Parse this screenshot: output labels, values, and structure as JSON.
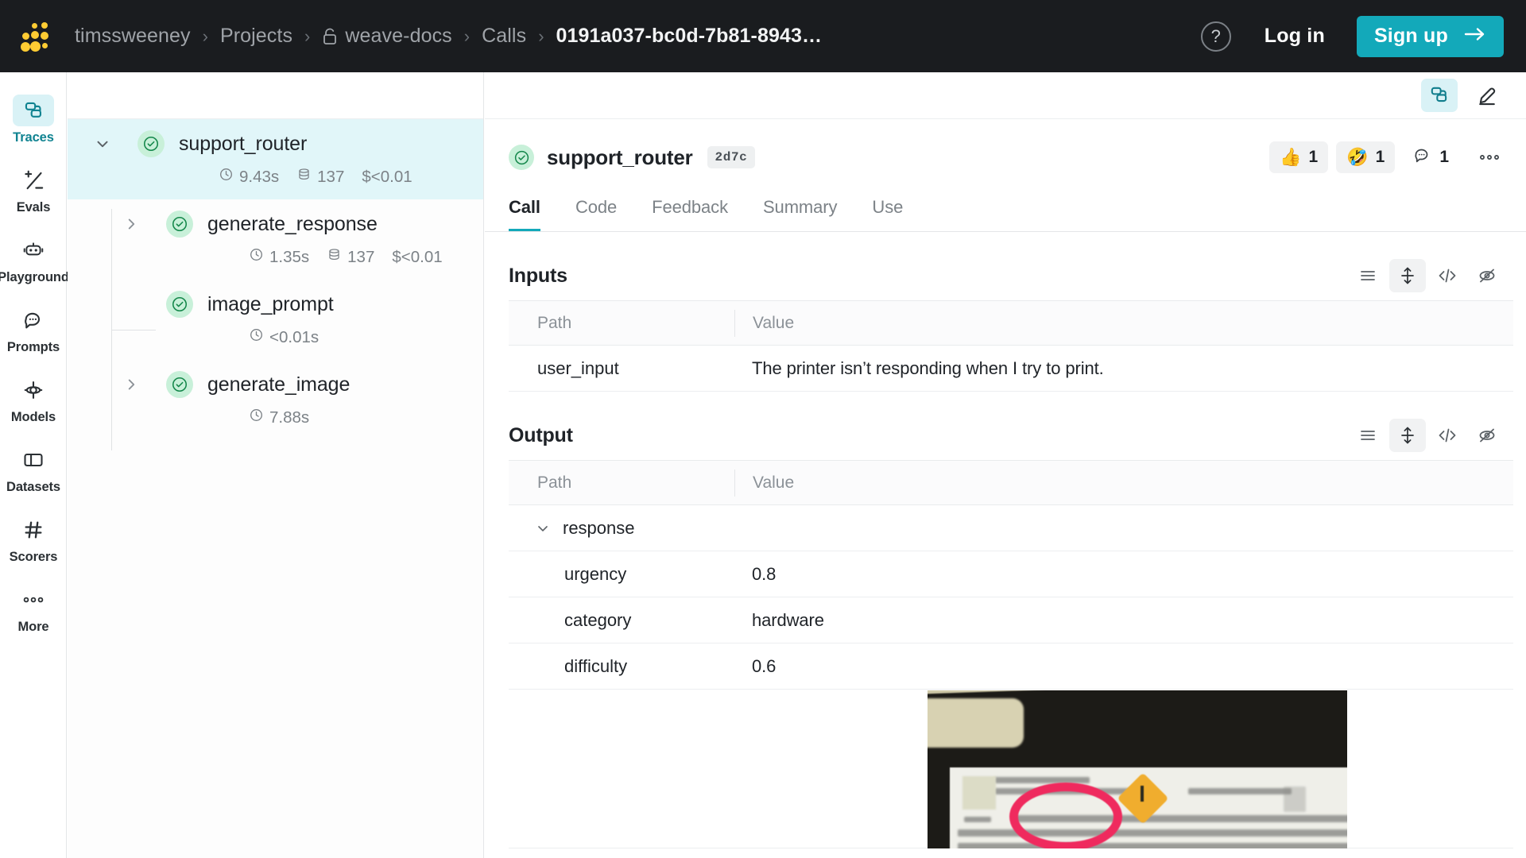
{
  "topbar": {
    "logo_name": "weights-and-biases-logo",
    "breadcrumbs": [
      {
        "label": "timssweeney",
        "strong": false,
        "icon": null
      },
      {
        "label": "Projects",
        "strong": false,
        "icon": null
      },
      {
        "label": "weave-docs",
        "strong": false,
        "icon": "lock-icon"
      },
      {
        "label": "Calls",
        "strong": false,
        "icon": null
      },
      {
        "label": "0191a037-bc0d-7b81-8943…",
        "strong": true,
        "icon": null
      }
    ],
    "separator": "›",
    "help_label": "?",
    "login_label": "Log in",
    "signup_label": "Sign up",
    "signup_arrow": "→",
    "accent_color": "#13a9ba",
    "background_color": "#1a1c1f"
  },
  "leftnav": {
    "items": [
      {
        "label": "Traces",
        "icon": "traces-icon",
        "active": true
      },
      {
        "label": "Evals",
        "icon": "evals-icon",
        "active": false
      },
      {
        "label": "Playground",
        "icon": "playground-icon",
        "active": false
      },
      {
        "label": "Prompts",
        "icon": "prompts-icon",
        "active": false
      },
      {
        "label": "Models",
        "icon": "models-icon",
        "active": false
      },
      {
        "label": "Datasets",
        "icon": "datasets-icon",
        "active": false
      },
      {
        "label": "Scorers",
        "icon": "scorers-icon",
        "active": false
      },
      {
        "label": "More",
        "icon": "more-icon",
        "active": false
      }
    ],
    "active_color": "#108391"
  },
  "tree": {
    "nodes": [
      {
        "name": "support_router",
        "status": "success",
        "selected": true,
        "expanded": true,
        "chevron": "down",
        "duration": "9.43s",
        "tokens": "137",
        "cost": "$<0.01",
        "depth": 0
      },
      {
        "name": "generate_response",
        "status": "success",
        "selected": false,
        "expanded": false,
        "chevron": "right",
        "duration": "1.35s",
        "tokens": "137",
        "cost": "$<0.01",
        "depth": 1
      },
      {
        "name": "image_prompt",
        "status": "success",
        "selected": false,
        "expanded": false,
        "chevron": "none",
        "duration": "<0.01s",
        "tokens": null,
        "cost": null,
        "depth": 1
      },
      {
        "name": "generate_image",
        "status": "success",
        "selected": false,
        "expanded": false,
        "chevron": "right",
        "duration": "7.88s",
        "tokens": null,
        "cost": null,
        "depth": 1
      }
    ]
  },
  "panel_toolbar": {
    "buttons": [
      {
        "icon": "traces-view-icon",
        "active": true
      },
      {
        "icon": "pen-highlighter-icon",
        "active": false
      }
    ]
  },
  "call": {
    "title": "support_router",
    "status": "success",
    "hash": "2d7c",
    "reactions": [
      {
        "icon": "thumbs-up-emoji",
        "emoji": "👍",
        "count": "1",
        "filled": true
      },
      {
        "icon": "rofl-emoji",
        "emoji": "🤣",
        "count": "1",
        "filled": true
      },
      {
        "icon": "comment-icon",
        "emoji": "",
        "count": "1",
        "filled": false
      }
    ],
    "overflow_icon": "more-horizontal-icon",
    "tabs": [
      {
        "label": "Call",
        "active": true
      },
      {
        "label": "Code",
        "active": false
      },
      {
        "label": "Feedback",
        "active": false
      },
      {
        "label": "Summary",
        "active": false
      },
      {
        "label": "Use",
        "active": false
      }
    ]
  },
  "inputs": {
    "title": "Inputs",
    "tools": [
      {
        "icon": "list-view-icon",
        "active": false
      },
      {
        "icon": "expand-rows-icon",
        "active": true
      },
      {
        "icon": "code-view-icon",
        "active": false
      },
      {
        "icon": "hide-icon",
        "active": false
      }
    ],
    "columns": [
      "Path",
      "Value"
    ],
    "rows": [
      {
        "path": "user_input",
        "value": "The printer isn’t responding when I try to print.",
        "indent": 1,
        "chevron": "none"
      }
    ]
  },
  "output": {
    "title": "Output",
    "tools": [
      {
        "icon": "list-view-icon",
        "active": false
      },
      {
        "icon": "expand-rows-icon",
        "active": true
      },
      {
        "icon": "code-view-icon",
        "active": false
      },
      {
        "icon": "hide-icon",
        "active": false
      }
    ],
    "columns": [
      "Path",
      "Value"
    ],
    "rows": [
      {
        "path": "response",
        "value": "",
        "indent": 1,
        "chevron": "down"
      },
      {
        "path": "urgency",
        "value": "0.8",
        "indent": 2,
        "chevron": "none"
      },
      {
        "path": "category",
        "value": "hardware",
        "indent": 2,
        "chevron": "none"
      },
      {
        "path": "difficulty",
        "value": "0.6",
        "indent": 2,
        "chevron": "none"
      }
    ],
    "image_row": {
      "name": "output-image-preview",
      "description": "blurry photo of a laptop screen with a red hand-drawn circle and yellow warning diamond"
    }
  }
}
